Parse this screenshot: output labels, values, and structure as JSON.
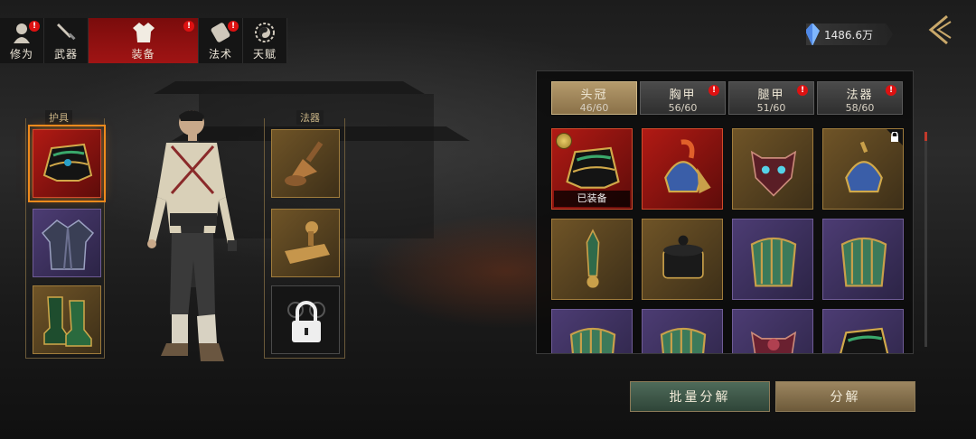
{
  "tabs": [
    {
      "label": "修为",
      "icon": "portrait-icon",
      "badge": "!"
    },
    {
      "label": "武器",
      "icon": "sword-icon",
      "badge": ""
    },
    {
      "label": "装备",
      "icon": "robe-icon",
      "badge": "!",
      "active": true
    },
    {
      "label": "法术",
      "icon": "scroll-icon",
      "badge": "!"
    },
    {
      "label": "天赋",
      "icon": "yin-yang-icon",
      "badge": ""
    }
  ],
  "currency": {
    "amount": "1486.6万",
    "icon": "crystal-icon"
  },
  "left_sections": {
    "armor_title": "护具",
    "artifact_title": "法器"
  },
  "inventory": {
    "tabs": [
      {
        "title": "头冠",
        "count": "46/60",
        "badge": "",
        "active": true
      },
      {
        "title": "胸甲",
        "count": "56/60",
        "badge": "!"
      },
      {
        "title": "腿甲",
        "count": "51/60",
        "badge": "!"
      },
      {
        "title": "法器",
        "count": "58/60",
        "badge": "!"
      }
    ],
    "items": [
      {
        "name": "helmet-crown",
        "rarity": "red",
        "equipped": true
      },
      {
        "name": "feathered-helmet",
        "rarity": "red"
      },
      {
        "name": "demon-mask",
        "rarity": "gold"
      },
      {
        "name": "feathered-helmet",
        "rarity": "gold",
        "locked": true
      },
      {
        "name": "jade-blade",
        "rarity": "gold"
      },
      {
        "name": "black-hat",
        "rarity": "gold"
      },
      {
        "name": "jade-bracer",
        "rarity": "purple"
      },
      {
        "name": "jade-bracer",
        "rarity": "purple"
      },
      {
        "name": "jade-bracer",
        "rarity": "purple"
      },
      {
        "name": "jade-bracer",
        "rarity": "purple"
      },
      {
        "name": "demon-mask",
        "rarity": "purple"
      },
      {
        "name": "helmet-crown",
        "rarity": "purple"
      }
    ],
    "equipped_label": "已装备"
  },
  "buttons": {
    "batch_dismantle": "批量分解",
    "dismantle": "分解"
  },
  "colors": {
    "accent_red": "#a01414",
    "gold_border": "#a07c3c",
    "purple": "#4c3c73"
  }
}
